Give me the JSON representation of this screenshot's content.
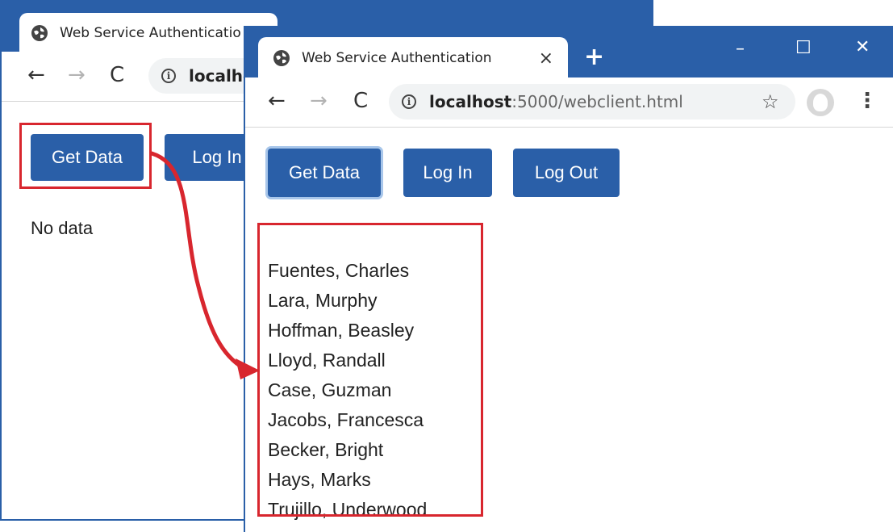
{
  "back_window": {
    "tab_title": "Web Service Authenticatio",
    "url_fragment": "localhc",
    "buttons": {
      "get_data": "Get Data",
      "log_in": "Log In"
    },
    "message": "No data"
  },
  "front_window": {
    "tab_title": "Web Service Authentication",
    "tab_close": "×",
    "new_tab": "+",
    "window_controls": {
      "minimize": "–",
      "maximize": "☐",
      "close": "✕"
    },
    "url_host": "localhost",
    "url_rest": ":5000/webclient.html",
    "buttons": {
      "get_data": "Get Data",
      "log_in": "Log In",
      "log_out": "Log Out"
    },
    "results": [
      "Fuentes, Charles",
      "Lara, Murphy",
      "Hoffman, Beasley",
      "Lloyd, Randall",
      "Case, Guzman",
      "Jacobs, Francesca",
      "Becker, Bright",
      "Hays, Marks",
      "Trujillo, Underwood"
    ]
  },
  "nav_glyphs": {
    "back": "←",
    "forward": "→",
    "reload": "C",
    "info": "i",
    "star": "☆",
    "menu": "⋮"
  },
  "colors": {
    "chrome_blue": "#2a5fa8",
    "button_blue": "#2a5fa8",
    "highlight_red": "#d8262e"
  }
}
